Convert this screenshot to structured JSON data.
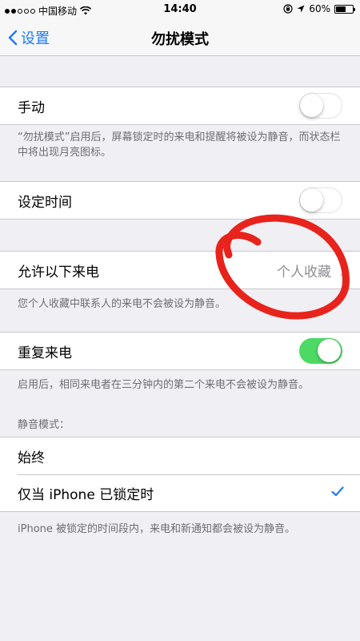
{
  "status_bar": {
    "carrier": "中国移动",
    "time": "14:40",
    "battery": "60%",
    "battery_level": 0.6
  },
  "nav": {
    "back_label": "设置",
    "title": "勿扰模式"
  },
  "manual": {
    "label": "手动",
    "on": false,
    "footer": "“勿扰模式”启用后，屏幕锁定时的来电和提醒将被设为静音，而状态栏中将出现月亮图标。"
  },
  "scheduled": {
    "label": "设定时间",
    "on": false
  },
  "allow_calls": {
    "label": "允许以下来电",
    "value": "个人收藏",
    "footer": "您个人收藏中联系人的来电不会被设为静音。"
  },
  "repeated_calls": {
    "label": "重复来电",
    "on": true,
    "footer": "启用后，相同来电者在三分钟内的第二个来电不会被设为静音。"
  },
  "silence": {
    "header": "静音模式：",
    "options": [
      {
        "label": "始终",
        "selected": false
      },
      {
        "label": "仅当 iPhone 已锁定时",
        "selected": true
      }
    ],
    "footer": "iPhone 被锁定的时间段内，来电和新通知都会被设为静音。"
  },
  "colors": {
    "accent": "#1f7cf5",
    "toggle_on": "#4cd964",
    "annotation": "#e8231b"
  }
}
